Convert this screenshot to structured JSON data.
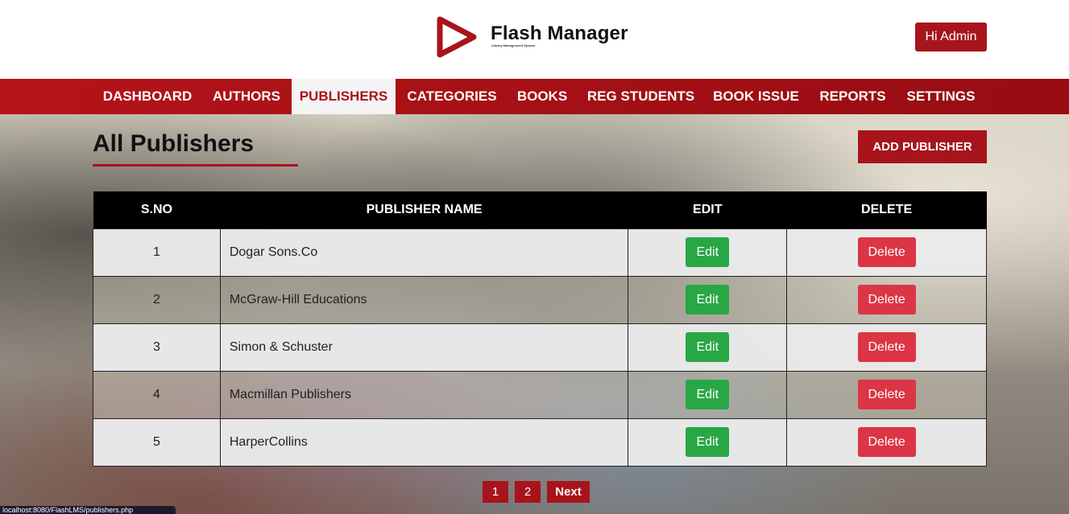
{
  "header": {
    "brand_title": "Flash Manager",
    "brand_subtitle": "Library Management System",
    "logo_icon": "play-triangle-icon",
    "admin_label": "Hi Admin"
  },
  "nav": {
    "items": [
      "DASHBOARD",
      "AUTHORS",
      "PUBLISHERS",
      "CATEGORIES",
      "BOOKS",
      "REG STUDENTS",
      "BOOK ISSUE",
      "REPORTS",
      "SETTINGS"
    ],
    "active": "PUBLISHERS"
  },
  "main": {
    "title": "All Publishers",
    "add_button": "ADD PUBLISHER",
    "table": {
      "headers": [
        "S.NO",
        "PUBLISHER NAME",
        "EDIT",
        "DELETE"
      ],
      "rows": [
        {
          "sno": "1",
          "name": "Dogar Sons.Co",
          "edit": "Edit",
          "delete": "Delete"
        },
        {
          "sno": "2",
          "name": "McGraw-Hill Educations",
          "edit": "Edit",
          "delete": "Delete"
        },
        {
          "sno": "3",
          "name": "Simon & Schuster",
          "edit": "Edit",
          "delete": "Delete"
        },
        {
          "sno": "4",
          "name": "Macmillan Publishers",
          "edit": "Edit",
          "delete": "Delete"
        },
        {
          "sno": "5",
          "name": "HarperCollins",
          "edit": "Edit",
          "delete": "Delete"
        }
      ]
    },
    "pagination": {
      "pages": [
        "1",
        "2"
      ],
      "next": "Next"
    }
  },
  "status_bar": {
    "url": "localhost:8080/FlashLMS/publishers.php"
  },
  "colors": {
    "brand_red": "#a8141b",
    "edit_green": "#28a745",
    "delete_red": "#dc3545",
    "table_header": "#000000"
  }
}
